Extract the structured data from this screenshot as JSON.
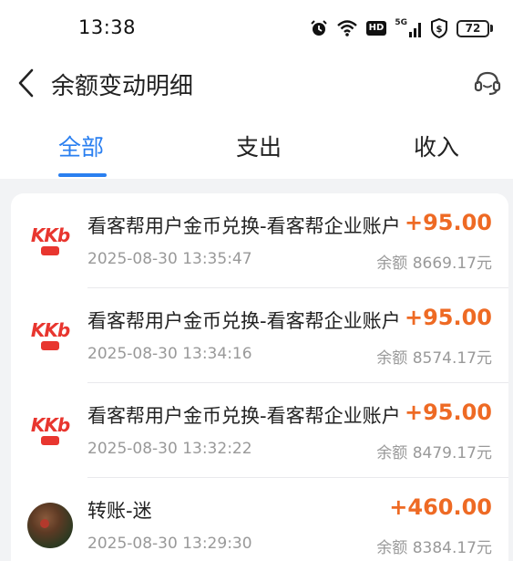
{
  "status_bar": {
    "time": "13:38",
    "signal_label": "5G",
    "hd_label": "HD",
    "battery": "72"
  },
  "header": {
    "title": "余额变动明细"
  },
  "tabs": [
    {
      "label": "全部",
      "active": true
    },
    {
      "label": "支出",
      "active": false
    },
    {
      "label": "收入",
      "active": false
    }
  ],
  "colors": {
    "accent": "#2a7ff0",
    "amount": "#ee6a24",
    "brand_red": "#e8362f"
  },
  "transactions": [
    {
      "avatar": "kkb-logo",
      "logo_text": "KKb",
      "title": "看客帮用户金币兑换-看客帮企业账户",
      "date": "2025-08-30 13:35:47",
      "amount": "+95.00",
      "balance": "余额 8669.17元"
    },
    {
      "avatar": "kkb-logo",
      "logo_text": "KKb",
      "title": "看客帮用户金币兑换-看客帮企业账户",
      "date": "2025-08-30 13:34:16",
      "amount": "+95.00",
      "balance": "余额 8574.17元"
    },
    {
      "avatar": "kkb-logo",
      "logo_text": "KKb",
      "title": "看客帮用户金币兑换-看客帮企业账户",
      "date": "2025-08-30 13:32:22",
      "amount": "+95.00",
      "balance": "余额 8479.17元"
    },
    {
      "avatar": "user-photo",
      "title": "转账-迷",
      "date": "2025-08-30 13:29:30",
      "amount": "+460.00",
      "balance": "余额 8384.17元"
    }
  ]
}
